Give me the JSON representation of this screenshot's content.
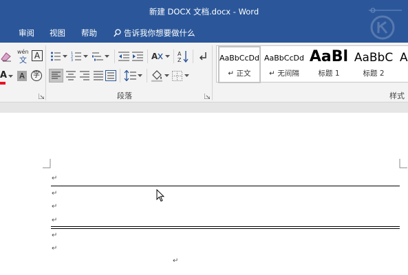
{
  "window": {
    "title": "新建 DOCX 文档.docx  -  Word"
  },
  "menu": {
    "items": [
      "审阅",
      "视图",
      "帮助"
    ],
    "tell_me": "告诉我你想要做什么"
  },
  "ribbon": {
    "groups": {
      "paragraph": "段落",
      "styles": "样式"
    },
    "font_icons": {
      "phonetic_guide_text": "wén",
      "phonetic_guide_char": "文",
      "char_border": "A",
      "text_effect": "A",
      "char_shading": "A",
      "enclose_char": "字"
    },
    "styles_gallery": [
      {
        "sample": "AaBbCcDd",
        "name": "正文",
        "mark": "↵"
      },
      {
        "sample": "AaBbCcDd",
        "name": "无间隔",
        "mark": "↵"
      },
      {
        "sample": "AaBl",
        "name": "标题 1"
      },
      {
        "sample": "AaBbC",
        "name": "标题 2"
      },
      {
        "sample": "A",
        "name": ""
      }
    ]
  },
  "document": {
    "paragraph_mark": "↵"
  },
  "colors": {
    "title_bar": "#2b579a",
    "ribbon_bg": "#f3f3f3",
    "page_bg": "#ffffff",
    "doc_bg": "#e6e6e6",
    "font_color_red": "#e81123",
    "highlight_blue": "#2b579a"
  }
}
